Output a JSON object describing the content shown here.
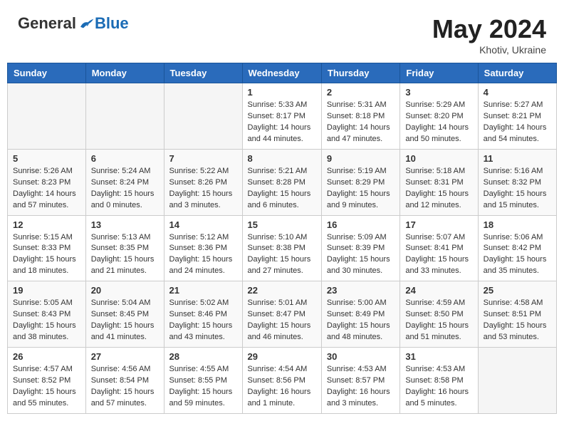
{
  "header": {
    "logo_general": "General",
    "logo_blue": "Blue",
    "month": "May 2024",
    "location": "Khotiv, Ukraine"
  },
  "weekdays": [
    "Sunday",
    "Monday",
    "Tuesday",
    "Wednesday",
    "Thursday",
    "Friday",
    "Saturday"
  ],
  "weeks": [
    [
      {
        "day": "",
        "info": ""
      },
      {
        "day": "",
        "info": ""
      },
      {
        "day": "",
        "info": ""
      },
      {
        "day": "1",
        "info": "Sunrise: 5:33 AM\nSunset: 8:17 PM\nDaylight: 14 hours\nand 44 minutes."
      },
      {
        "day": "2",
        "info": "Sunrise: 5:31 AM\nSunset: 8:18 PM\nDaylight: 14 hours\nand 47 minutes."
      },
      {
        "day": "3",
        "info": "Sunrise: 5:29 AM\nSunset: 8:20 PM\nDaylight: 14 hours\nand 50 minutes."
      },
      {
        "day": "4",
        "info": "Sunrise: 5:27 AM\nSunset: 8:21 PM\nDaylight: 14 hours\nand 54 minutes."
      }
    ],
    [
      {
        "day": "5",
        "info": "Sunrise: 5:26 AM\nSunset: 8:23 PM\nDaylight: 14 hours\nand 57 minutes."
      },
      {
        "day": "6",
        "info": "Sunrise: 5:24 AM\nSunset: 8:24 PM\nDaylight: 15 hours\nand 0 minutes."
      },
      {
        "day": "7",
        "info": "Sunrise: 5:22 AM\nSunset: 8:26 PM\nDaylight: 15 hours\nand 3 minutes."
      },
      {
        "day": "8",
        "info": "Sunrise: 5:21 AM\nSunset: 8:28 PM\nDaylight: 15 hours\nand 6 minutes."
      },
      {
        "day": "9",
        "info": "Sunrise: 5:19 AM\nSunset: 8:29 PM\nDaylight: 15 hours\nand 9 minutes."
      },
      {
        "day": "10",
        "info": "Sunrise: 5:18 AM\nSunset: 8:31 PM\nDaylight: 15 hours\nand 12 minutes."
      },
      {
        "day": "11",
        "info": "Sunrise: 5:16 AM\nSunset: 8:32 PM\nDaylight: 15 hours\nand 15 minutes."
      }
    ],
    [
      {
        "day": "12",
        "info": "Sunrise: 5:15 AM\nSunset: 8:33 PM\nDaylight: 15 hours\nand 18 minutes."
      },
      {
        "day": "13",
        "info": "Sunrise: 5:13 AM\nSunset: 8:35 PM\nDaylight: 15 hours\nand 21 minutes."
      },
      {
        "day": "14",
        "info": "Sunrise: 5:12 AM\nSunset: 8:36 PM\nDaylight: 15 hours\nand 24 minutes."
      },
      {
        "day": "15",
        "info": "Sunrise: 5:10 AM\nSunset: 8:38 PM\nDaylight: 15 hours\nand 27 minutes."
      },
      {
        "day": "16",
        "info": "Sunrise: 5:09 AM\nSunset: 8:39 PM\nDaylight: 15 hours\nand 30 minutes."
      },
      {
        "day": "17",
        "info": "Sunrise: 5:07 AM\nSunset: 8:41 PM\nDaylight: 15 hours\nand 33 minutes."
      },
      {
        "day": "18",
        "info": "Sunrise: 5:06 AM\nSunset: 8:42 PM\nDaylight: 15 hours\nand 35 minutes."
      }
    ],
    [
      {
        "day": "19",
        "info": "Sunrise: 5:05 AM\nSunset: 8:43 PM\nDaylight: 15 hours\nand 38 minutes."
      },
      {
        "day": "20",
        "info": "Sunrise: 5:04 AM\nSunset: 8:45 PM\nDaylight: 15 hours\nand 41 minutes."
      },
      {
        "day": "21",
        "info": "Sunrise: 5:02 AM\nSunset: 8:46 PM\nDaylight: 15 hours\nand 43 minutes."
      },
      {
        "day": "22",
        "info": "Sunrise: 5:01 AM\nSunset: 8:47 PM\nDaylight: 15 hours\nand 46 minutes."
      },
      {
        "day": "23",
        "info": "Sunrise: 5:00 AM\nSunset: 8:49 PM\nDaylight: 15 hours\nand 48 minutes."
      },
      {
        "day": "24",
        "info": "Sunrise: 4:59 AM\nSunset: 8:50 PM\nDaylight: 15 hours\nand 51 minutes."
      },
      {
        "day": "25",
        "info": "Sunrise: 4:58 AM\nSunset: 8:51 PM\nDaylight: 15 hours\nand 53 minutes."
      }
    ],
    [
      {
        "day": "26",
        "info": "Sunrise: 4:57 AM\nSunset: 8:52 PM\nDaylight: 15 hours\nand 55 minutes."
      },
      {
        "day": "27",
        "info": "Sunrise: 4:56 AM\nSunset: 8:54 PM\nDaylight: 15 hours\nand 57 minutes."
      },
      {
        "day": "28",
        "info": "Sunrise: 4:55 AM\nSunset: 8:55 PM\nDaylight: 15 hours\nand 59 minutes."
      },
      {
        "day": "29",
        "info": "Sunrise: 4:54 AM\nSunset: 8:56 PM\nDaylight: 16 hours\nand 1 minute."
      },
      {
        "day": "30",
        "info": "Sunrise: 4:53 AM\nSunset: 8:57 PM\nDaylight: 16 hours\nand 3 minutes."
      },
      {
        "day": "31",
        "info": "Sunrise: 4:53 AM\nSunset: 8:58 PM\nDaylight: 16 hours\nand 5 minutes."
      },
      {
        "day": "",
        "info": ""
      }
    ]
  ]
}
